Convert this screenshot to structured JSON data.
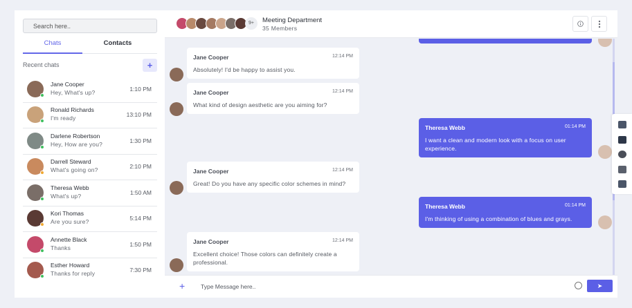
{
  "sidebar": {
    "search_placeholder": "Search here..",
    "tabs": [
      {
        "label": "Chats",
        "active": true
      },
      {
        "label": "Contacts",
        "active": false
      }
    ],
    "recent_title": "Recent chats",
    "add_icon": "+",
    "contacts": [
      {
        "name": "Jane Cooper",
        "message": "Hey, What's up?",
        "time": "1:10 PM",
        "status_color": "#3fbf5f",
        "avatar_color": "#8a6a58"
      },
      {
        "name": "Ronald Richards",
        "message": "I'm ready",
        "time": "13:10 PM",
        "status_color": "#3fbf5f",
        "avatar_color": "#c9a27a"
      },
      {
        "name": "Darlene Robertson",
        "message": "Hey, How are you?",
        "time": "1:30 PM",
        "status_color": "#3fbf5f",
        "avatar_color": "#7f8a86"
      },
      {
        "name": "Darrell Steward",
        "message": "What's going on?",
        "time": "2:10 PM",
        "status_color": "#f0a830",
        "avatar_color": "#c98a5e"
      },
      {
        "name": "Theresa Webb",
        "message": "What's up?",
        "time": "1:50 AM",
        "status_color": "#3fbf5f",
        "avatar_color": "#7a6e68"
      },
      {
        "name": "Kori Thomas",
        "message": "Are you sure?",
        "time": "5:14 PM",
        "status_color": "#f0a830",
        "avatar_color": "#5a3a34"
      },
      {
        "name": "Annette Black",
        "message": "Thanks",
        "time": "1:50 PM",
        "status_color": "#3fbf5f",
        "avatar_color": "#c44a6a"
      },
      {
        "name": "Esther Howard",
        "message": "Thanks for reply",
        "time": "7:30 PM",
        "status_color": "#3fbf5f",
        "avatar_color": "#a45a4e"
      }
    ]
  },
  "header": {
    "title": "Meeting Department",
    "subtitle": "35 Members",
    "more_members": "9+",
    "member_avatar_colors": [
      "#c44a6a",
      "#b88a6a",
      "#6a4a40",
      "#a57a62",
      "#caa48a",
      "#7a6e68",
      "#5a3a34"
    ],
    "info_icon": "info-icon",
    "menu_icon": "kebab-menu-icon"
  },
  "messages": [
    {
      "sender": "Jane Cooper",
      "time": "12:14 PM",
      "text": "Absolutely! I'd be happy to assist you.",
      "direction": "in"
    },
    {
      "sender": "Jane Cooper",
      "time": "12:14 PM",
      "text": "What kind of design aesthetic are you aiming for?",
      "direction": "in"
    },
    {
      "sender": "Theresa Webb",
      "time": "01:14 PM",
      "text_lines": [
        "I want a clean and modern look with a focus on user",
        "experience."
      ],
      "direction": "out"
    },
    {
      "sender": "Jane Cooper",
      "time": "12:14 PM",
      "text": "Great! Do you have any specific color schemes in mind?",
      "direction": "in"
    },
    {
      "sender": "Theresa Webb",
      "time": "01:14 PM",
      "text": "I'm thinking of using a combination of blues and grays.",
      "direction": "out"
    },
    {
      "sender": "Jane Cooper",
      "time": "12:14 PM",
      "text_lines": [
        "Excellent choice! Those colors can definitely create a",
        "professional."
      ],
      "direction": "in"
    }
  ],
  "composer": {
    "placeholder": "Type Message here..",
    "plus_icon": "+",
    "send_icon": "➤"
  },
  "colors": {
    "accent": "#5b5fe6",
    "incoming_bubble": "#ffffff",
    "background": "#eef0f6"
  },
  "toolbar_icons": [
    "user-icon",
    "hat-icon",
    "settings-icon",
    "grid-icon",
    "basket-icon"
  ]
}
